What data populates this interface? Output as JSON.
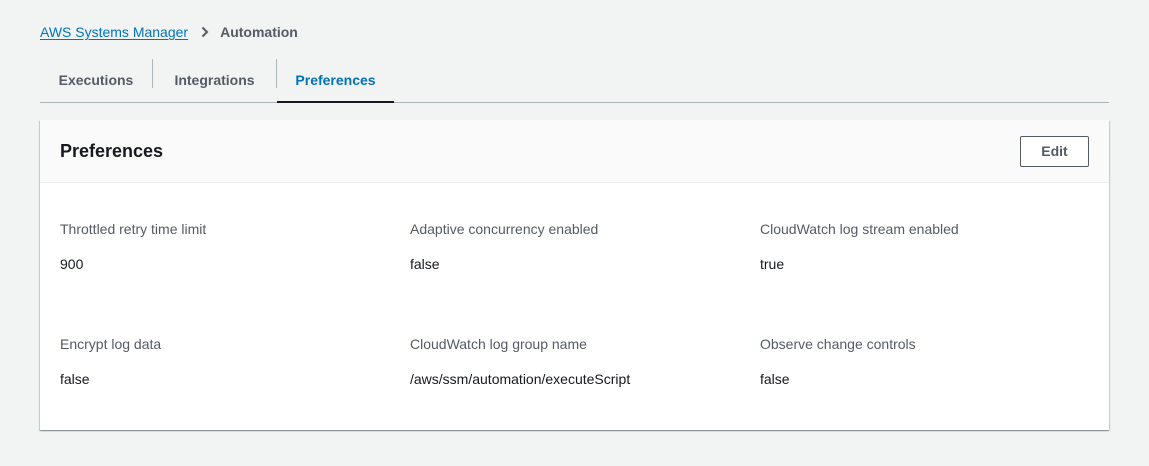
{
  "breadcrumb": {
    "root": "AWS Systems Manager",
    "current": "Automation"
  },
  "tabs": [
    {
      "label": "Executions",
      "active": false
    },
    {
      "label": "Integrations",
      "active": false
    },
    {
      "label": "Preferences",
      "active": true
    }
  ],
  "panel": {
    "title": "Preferences",
    "edit_label": "Edit",
    "fields": [
      {
        "label": "Throttled retry time limit",
        "value": "900"
      },
      {
        "label": "Adaptive concurrency enabled",
        "value": "false"
      },
      {
        "label": "CloudWatch log stream enabled",
        "value": "true"
      },
      {
        "label": "Encrypt log data",
        "value": "false"
      },
      {
        "label": "CloudWatch log group name",
        "value": "/aws/ssm/automation/executeScript"
      },
      {
        "label": "Observe change controls",
        "value": "false"
      }
    ]
  },
  "colors": {
    "link": "#0073bb",
    "text": "#16191f",
    "muted": "#545b64",
    "background": "#f2f3f3"
  }
}
